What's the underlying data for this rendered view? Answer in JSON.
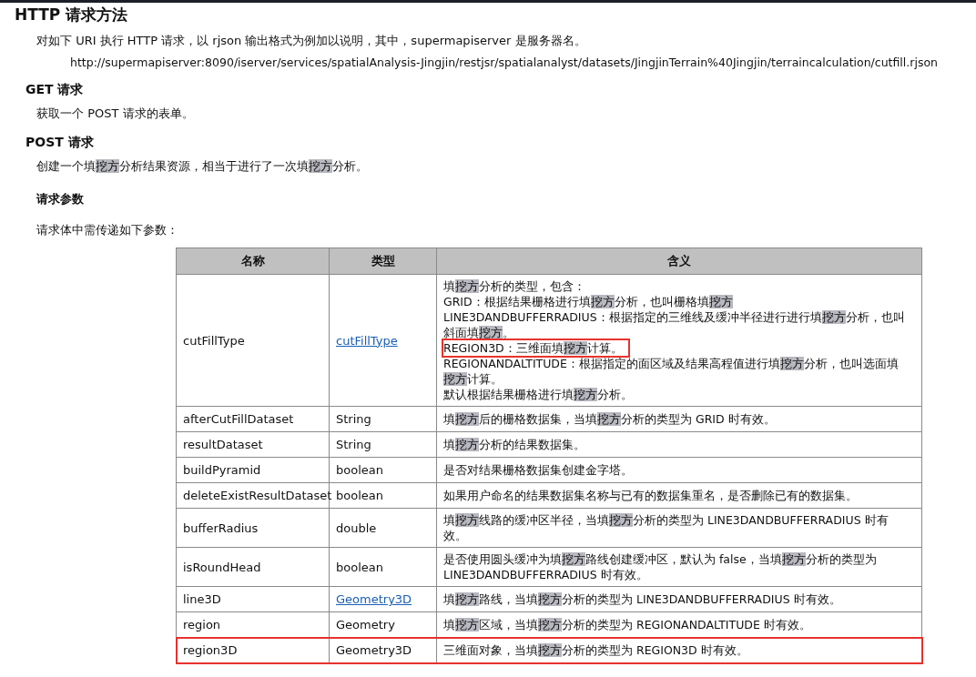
{
  "title": "HTTP 请求方法",
  "intro": "对如下 URI 执行 HTTP 请求，以 rjson 输出格式为例加以说明，其中，supermapiserver 是服务器名。",
  "uri": "http://supermapiserver:8090/iserver/services/spatialAnalysis-Jingjin/restjsr/spatialanalyst/datasets/JingjinTerrain%40Jingjin/terraincalculation/cutfill.rjson",
  "sections": [
    {
      "heading": "GET 请求",
      "text": [
        {
          "t": "获取一个 POST 请求的表单。",
          "hl": false
        }
      ]
    },
    {
      "heading": "POST 请求",
      "text": [
        {
          "t": "创建一个填",
          "hl": false
        },
        {
          "t": "挖方",
          "hl": true
        },
        {
          "t": "分析结果资源，相当于进行了一次填",
          "hl": false
        },
        {
          "t": "挖方",
          "hl": true
        },
        {
          "t": "分析。",
          "hl": false
        }
      ]
    }
  ],
  "params_heading": "请求参数",
  "params_intro": "请求体中需传递如下参数：",
  "table": {
    "columns": [
      "名称",
      "类型",
      "含义"
    ],
    "rows": [
      {
        "name": "cutFillType",
        "type": "cutFillType",
        "type_link": true,
        "marked": false,
        "meaning": [
          {
            "marked": false,
            "parts": [
              {
                "t": "填",
                "hl": false
              },
              {
                "t": "挖方",
                "hl": true
              },
              {
                "t": "分析的类型，包含：",
                "hl": false
              }
            ]
          },
          {
            "marked": false,
            "parts": [
              {
                "t": "GRID：根据结果栅格进行填",
                "hl": false
              },
              {
                "t": "挖方",
                "hl": true
              },
              {
                "t": "分析，也叫栅格填",
                "hl": false
              },
              {
                "t": "挖方",
                "hl": true
              }
            ]
          },
          {
            "marked": false,
            "parts": [
              {
                "t": "LINE3DANDBUFFERRADIUS：根据指定的三维线及缓冲半径进行进行填",
                "hl": false
              },
              {
                "t": "挖方",
                "hl": true
              },
              {
                "t": "分析，也叫斜面填",
                "hl": false
              },
              {
                "t": "挖方",
                "hl": true
              },
              {
                "t": "。",
                "hl": false
              }
            ]
          },
          {
            "marked": true,
            "parts": [
              {
                "t": "REGION3D：三维面填",
                "hl": false
              },
              {
                "t": "挖方",
                "hl": true
              },
              {
                "t": "计算。",
                "hl": false
              }
            ]
          },
          {
            "marked": false,
            "parts": [
              {
                "t": "REGIONANDALTITUDE：根据指定的面区域及结果高程值进行填",
                "hl": false
              },
              {
                "t": "挖方",
                "hl": true
              },
              {
                "t": "分析，也叫选面填",
                "hl": false
              },
              {
                "t": "挖方",
                "hl": true
              },
              {
                "t": "计算。",
                "hl": false
              }
            ]
          },
          {
            "marked": false,
            "parts": [
              {
                "t": "默认根据结果栅格进行填",
                "hl": false
              },
              {
                "t": "挖方",
                "hl": true
              },
              {
                "t": "分析。",
                "hl": false
              }
            ]
          }
        ]
      },
      {
        "name": "afterCutFillDataset",
        "type": "String",
        "type_link": false,
        "marked": false,
        "meaning": [
          {
            "marked": false,
            "parts": [
              {
                "t": "填",
                "hl": false
              },
              {
                "t": "挖方",
                "hl": true
              },
              {
                "t": "后的栅格数据集，当填",
                "hl": false
              },
              {
                "t": "挖方",
                "hl": true
              },
              {
                "t": "分析的类型为 GRID 时有效。",
                "hl": false
              }
            ]
          }
        ]
      },
      {
        "name": "resultDataset",
        "type": "String",
        "type_link": false,
        "marked": false,
        "meaning": [
          {
            "marked": false,
            "parts": [
              {
                "t": "填",
                "hl": false
              },
              {
                "t": "挖方",
                "hl": true
              },
              {
                "t": "分析的结果数据集。",
                "hl": false
              }
            ]
          }
        ]
      },
      {
        "name": "buildPyramid",
        "type": "boolean",
        "type_link": false,
        "marked": false,
        "meaning": [
          {
            "marked": false,
            "parts": [
              {
                "t": "是否对结果栅格数据集创建金字塔。",
                "hl": false
              }
            ]
          }
        ]
      },
      {
        "name": "deleteExistResultDataset",
        "type": "boolean",
        "type_link": false,
        "marked": false,
        "meaning": [
          {
            "marked": false,
            "parts": [
              {
                "t": "如果用户命名的结果数据集名称与已有的数据集重名，是否删除已有的数据集。",
                "hl": false
              }
            ]
          }
        ]
      },
      {
        "name": "bufferRadius",
        "type": "double",
        "type_link": false,
        "marked": false,
        "meaning": [
          {
            "marked": false,
            "parts": [
              {
                "t": "填",
                "hl": false
              },
              {
                "t": "挖方",
                "hl": true
              },
              {
                "t": "线路的缓冲区半径，当填",
                "hl": false
              },
              {
                "t": "挖方",
                "hl": true
              },
              {
                "t": "分析的类型为 LINE3DANDBUFFERRADIUS 时有效。",
                "hl": false
              }
            ]
          }
        ]
      },
      {
        "name": "isRoundHead",
        "type": "boolean",
        "type_link": false,
        "marked": false,
        "meaning": [
          {
            "marked": false,
            "parts": [
              {
                "t": "是否使用圆头缓冲为填",
                "hl": false
              },
              {
                "t": "挖方",
                "hl": true
              },
              {
                "t": "路线创建缓冲区，默认为 false，当填",
                "hl": false
              },
              {
                "t": "挖方",
                "hl": true
              },
              {
                "t": "分析的类型为 LINE3DANDBUFFERRADIUS 时有效。",
                "hl": false
              }
            ]
          }
        ]
      },
      {
        "name": "line3D",
        "type": "Geometry3D",
        "type_link": true,
        "marked": false,
        "meaning": [
          {
            "marked": false,
            "parts": [
              {
                "t": "填",
                "hl": false
              },
              {
                "t": "挖方",
                "hl": true
              },
              {
                "t": "路线，当填",
                "hl": false
              },
              {
                "t": "挖方",
                "hl": true
              },
              {
                "t": "分析的类型为 LINE3DANDBUFFERRADIUS 时有效。",
                "hl": false
              }
            ]
          }
        ]
      },
      {
        "name": "region",
        "type": "Geometry",
        "type_link": false,
        "marked": false,
        "meaning": [
          {
            "marked": false,
            "parts": [
              {
                "t": "填",
                "hl": false
              },
              {
                "t": "挖方",
                "hl": true
              },
              {
                "t": "区域，当填",
                "hl": false
              },
              {
                "t": "挖方",
                "hl": true
              },
              {
                "t": "分析的类型为 REGIONANDALTITUDE 时有效。",
                "hl": false
              }
            ]
          }
        ]
      },
      {
        "name": "region3D",
        "type": "Geometry3D",
        "type_link": false,
        "marked": true,
        "meaning": [
          {
            "marked": false,
            "parts": [
              {
                "t": "三维面对象，当填",
                "hl": false
              },
              {
                "t": "挖方",
                "hl": true
              },
              {
                "t": "分析的类型为 REGION3D 时有效。",
                "hl": false
              }
            ]
          }
        ]
      }
    ]
  }
}
